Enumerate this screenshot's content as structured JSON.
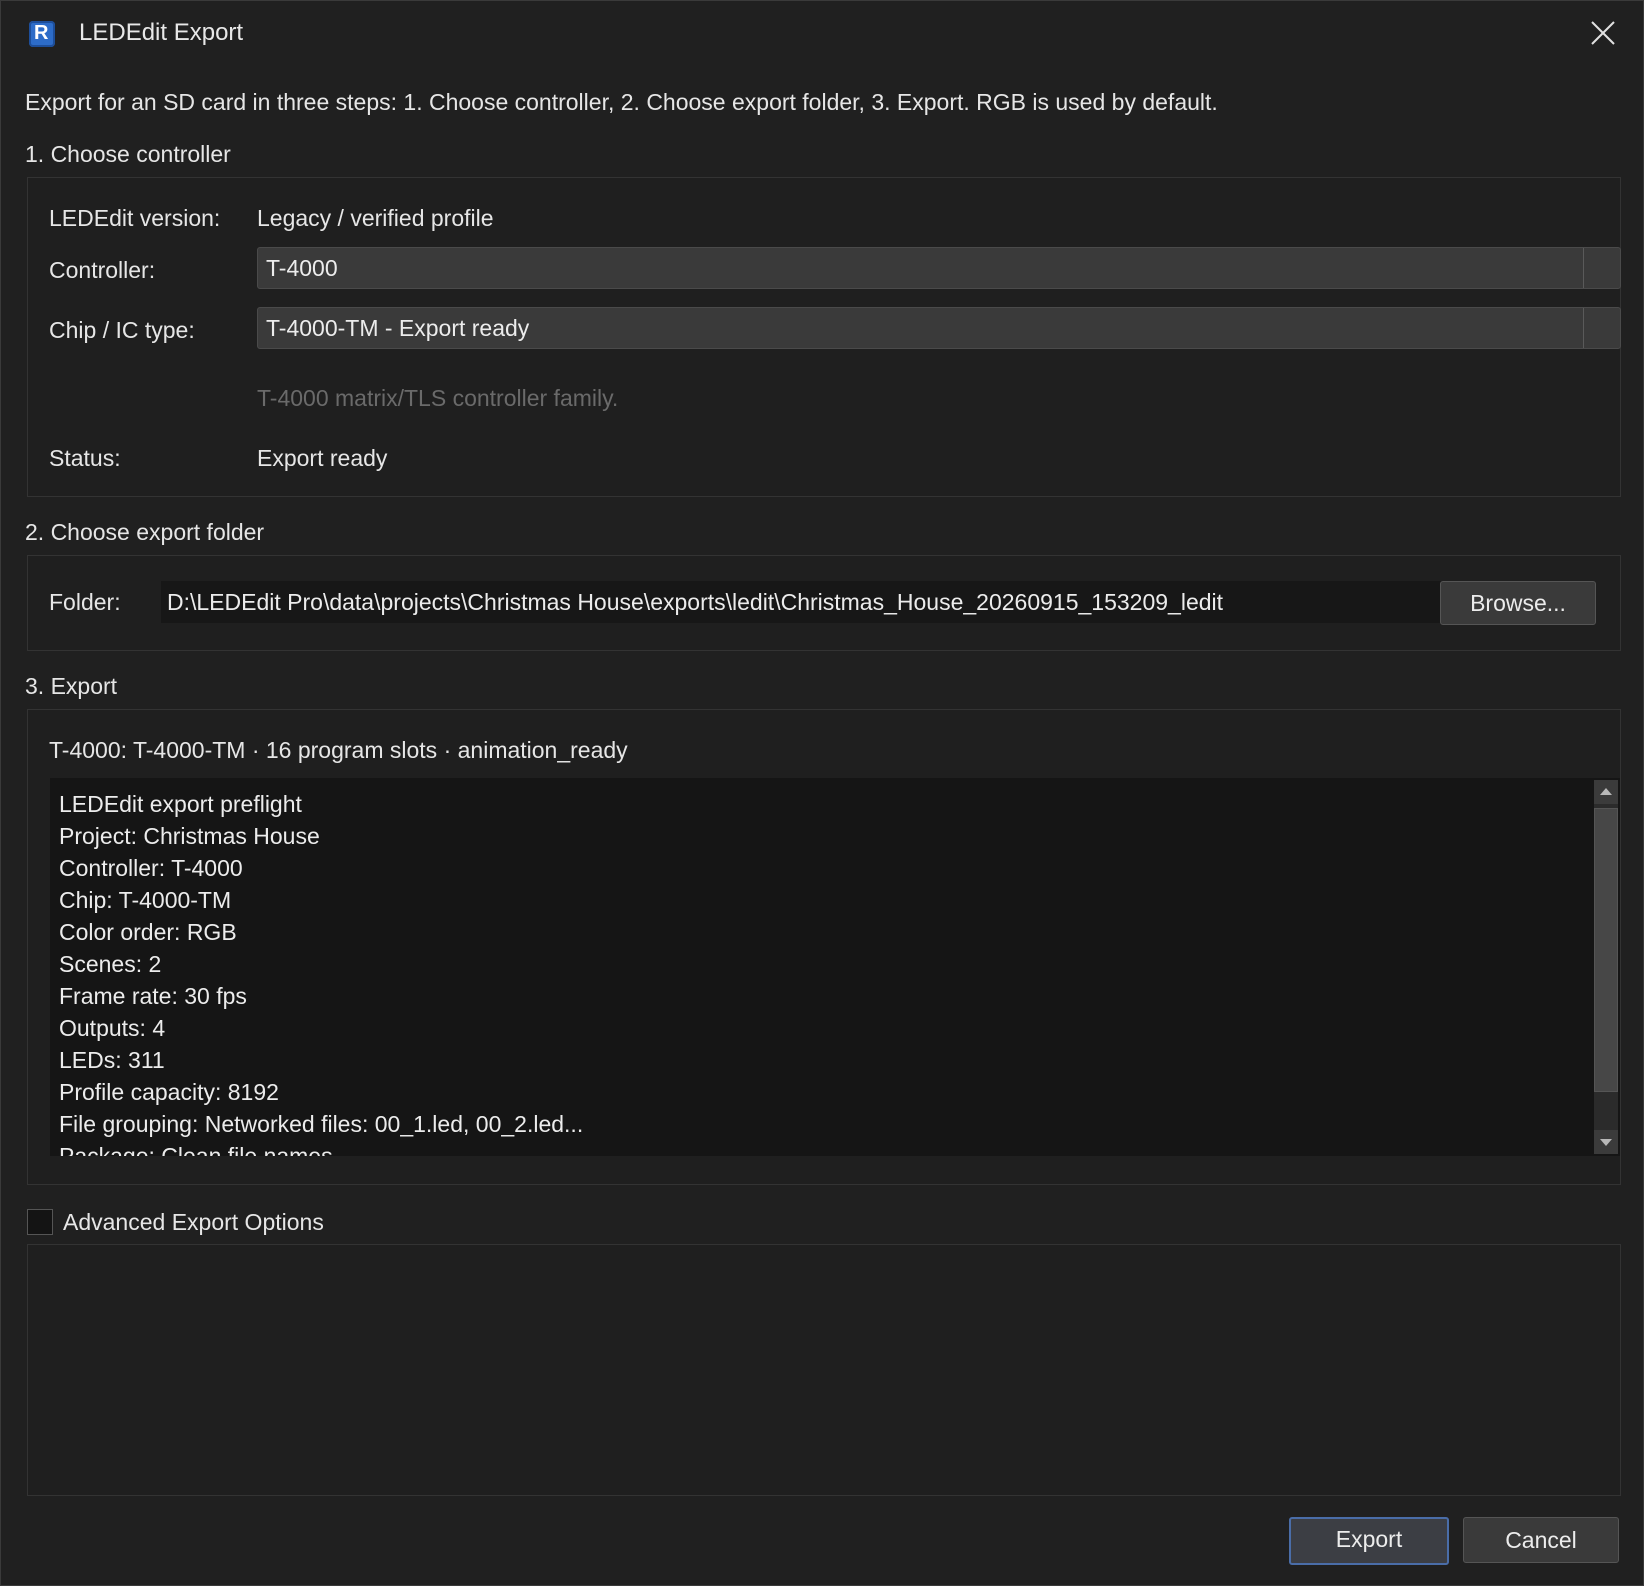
{
  "window": {
    "title": "LEDEdit Export",
    "icon_letter": "R"
  },
  "intro": "Export for an SD card in three steps: 1. Choose controller, 2. Choose export folder, 3. Export. RGB is used by default.",
  "step1": {
    "title": "1. Choose controller",
    "version_label": "LEDEdit version:",
    "version_value": "Legacy / verified profile",
    "controller_label": "Controller:",
    "controller_value": "T-4000",
    "chip_label": "Chip / IC type:",
    "chip_value": "T-4000-TM - Export ready",
    "hint": "T-4000 matrix/TLS controller family.",
    "status_label": "Status:",
    "status_value": "Export ready"
  },
  "step2": {
    "title": "2. Choose export folder",
    "folder_label": "Folder:",
    "folder_value": "D:\\LEDEdit Pro\\data\\projects\\Christmas House\\exports\\ledit\\Christmas_House_20260915_153209_ledit",
    "browse_label": "Browse..."
  },
  "step3": {
    "title": "3. Export",
    "summary": "T-4000: T-4000-TM · 16 program slots · animation_ready",
    "preflight_lines": [
      "LEDEdit export preflight",
      "Project: Christmas House",
      "Controller: T-4000",
      "Chip: T-4000-TM",
      "Color order: RGB",
      "Scenes: 2",
      "Frame rate: 30 fps",
      "Outputs: 4",
      "LEDs: 311",
      "Profile capacity: 8192",
      "File grouping: Networked files: 00_1.led, 00_2.led...",
      "Package: Clean file names"
    ]
  },
  "advanced": {
    "label": "Advanced Export Options",
    "checked": false
  },
  "buttons": {
    "export": "Export",
    "cancel": "Cancel"
  }
}
